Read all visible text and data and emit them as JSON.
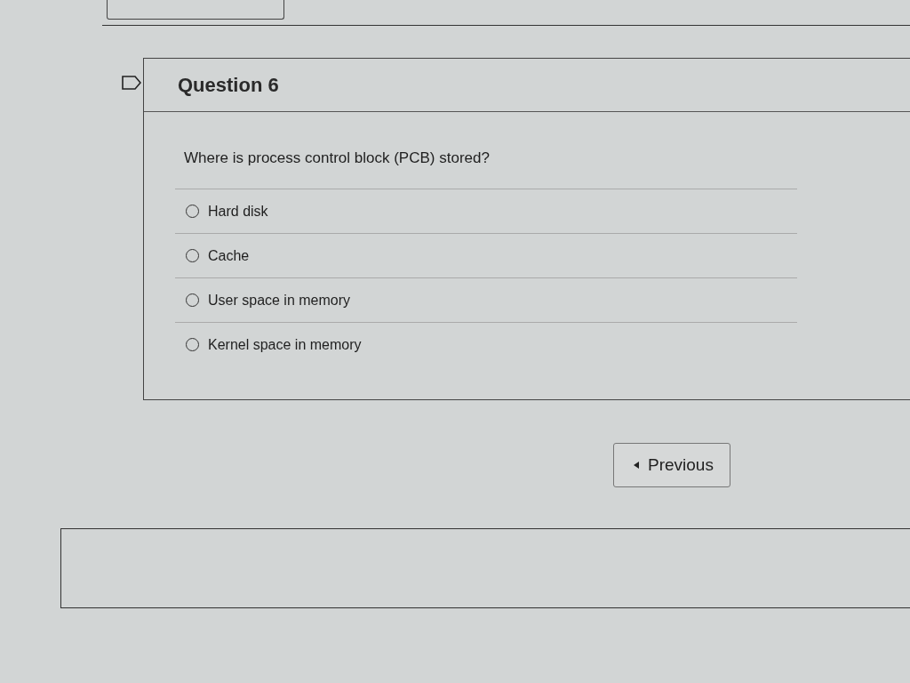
{
  "question": {
    "title": "Question 6",
    "flagged": false,
    "text": "Where is process control block (PCB) stored?",
    "options": [
      {
        "label": "Hard disk",
        "selected": false
      },
      {
        "label": "Cache",
        "selected": false
      },
      {
        "label": "User space in memory",
        "selected": false
      },
      {
        "label": "Kernel space in memory",
        "selected": false
      }
    ]
  },
  "navigation": {
    "previous": "Previous"
  }
}
